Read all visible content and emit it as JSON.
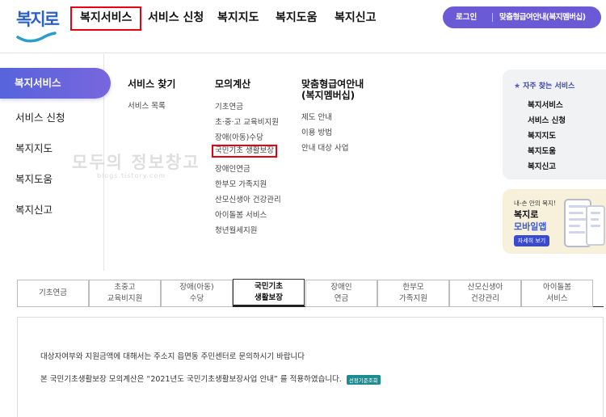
{
  "header": {
    "logo_text": "복지로",
    "nav": [
      "복지서비스",
      "서비스 신청",
      "복지지도",
      "복지도움",
      "복지신고"
    ],
    "login": "로그인",
    "custom_benefit": "맞춤형급여안내(복지멤버십)"
  },
  "side_menu": {
    "active": "복지서비스",
    "items": [
      "서비스 신청",
      "복지지도",
      "복지도움",
      "복지신고"
    ]
  },
  "columns": {
    "find_service": {
      "title": "서비스 찾기",
      "links": [
        "서비스 목록"
      ]
    },
    "calculation": {
      "title": "모의계산",
      "links": [
        "기초연금",
        "초·중·고 교육비지원",
        "장애(아동)수당",
        "국민기초 생활보장",
        "장애인연금",
        "한부모 가족지원",
        "산모신생아 건강관리",
        "아이돌봄 서비스",
        "청년월세지원"
      ]
    },
    "custom": {
      "title_line1": "맞춤형급여안내",
      "title_line2": "(복지멤버십)",
      "links": [
        "제도 안내",
        "이용 방법",
        "안내 대상 사업"
      ]
    }
  },
  "watermark": {
    "main": "모두의 정보창고",
    "sub": "blogs.tistory.com"
  },
  "favorites": {
    "title": "자주 찾는 서비스",
    "links": [
      "복지서비스",
      "서비스 신청",
      "복지지도",
      "복지도움",
      "복지신고"
    ]
  },
  "app_banner": {
    "small": "내-손 안의 복지!",
    "title1": "복지로",
    "title2": "모바일앱",
    "button": "자세히 보기"
  },
  "tabs": [
    "기초연금",
    "초중고\n교육비지원",
    "장애(아동)\n수당",
    "국민기초\n생활보장",
    "장애인\n연금",
    "한부모\n가족지원",
    "산모신생아\n건강관리",
    "아이돌봄\n서비스"
  ],
  "active_tab_index": 3,
  "content": {
    "line1": "대상자여부와 지원금액에 대해서는 주소지 읍면동 주민센터로 문의하시기 바랍니다",
    "line2": "본 국민기초생활보장 모의계산은 “2021년도 국민기초생활보장사업 안내” 를 적용하였습니다.",
    "criteria_button": "선정기준조회"
  },
  "colors": {
    "accent": "#6a5ad6",
    "highlight_border": "#e60012",
    "logo_blue": "#2b62c9"
  }
}
